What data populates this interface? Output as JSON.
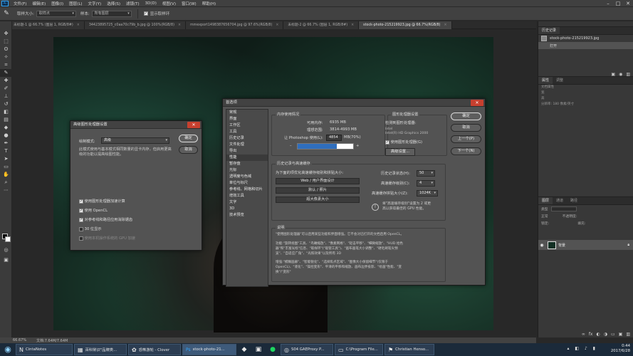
{
  "menubar": {
    "items": [
      "文件(F)",
      "编辑(E)",
      "图像(I)",
      "图层(L)",
      "文字(Y)",
      "选择(S)",
      "滤镜(T)",
      "3D(D)",
      "视图(V)",
      "窗口(W)",
      "帮助(H)"
    ],
    "window_controls": [
      "–",
      "□",
      "✕"
    ]
  },
  "options": {
    "sample_size_label": "取样大小:",
    "sample_size_value": "取样点",
    "sample_label": "样本:",
    "sample_value": "所有图层",
    "show_ring_label": "显示取样环"
  },
  "tabs": [
    {
      "label": "未标题-1 @ 66.7% (图层 1, RGB/8#)",
      "active": false
    },
    {
      "label": "34423895725_c0aa70c79b_b.jpg @ 100%(RGB/8)",
      "active": false
    },
    {
      "label": "mmexport1498387656704.jpg @ 97.6%(RGB/8)",
      "active": false
    },
    {
      "label": "未标题-2 @ 66.7% (图层 1, RGB/8#)",
      "active": false
    },
    {
      "label": "stock-photo-215219923.jpg @ 66.7%(RGB/8)",
      "active": true
    }
  ],
  "statusbar": {
    "zoom": "66.67%",
    "doc": "文档:7.64M/7.64M"
  },
  "gpu_dialog": {
    "title": "高级图形处理器设置",
    "mode_label": "绘制模式:",
    "mode_value": "高级",
    "description": "此模式使用与基本模式相同数量的显卡内存，但启用更高级的功能以提高绘图性能。",
    "ok": "确定",
    "cancel": "取消",
    "options": [
      {
        "label": "使用图形处理器加速计算",
        "checked": true,
        "enabled": true
      },
      {
        "label": "使用 OpenCL",
        "checked": true,
        "enabled": true
      },
      {
        "label": "对参考线和路径应用消除锯齿",
        "checked": true,
        "enabled": true
      },
      {
        "label": "30 位显示",
        "checked": false,
        "enabled": true
      },
      {
        "label": "使用本机操作系统的 GPU 加速",
        "checked": false,
        "enabled": false
      }
    ]
  },
  "prefs_dialog": {
    "title": "首选项",
    "nav": [
      "常规",
      "界面",
      "工作区",
      "工具",
      "历史记录",
      "文件处理",
      "导出",
      "性能",
      "暂存盘",
      "光标",
      "透明度与色域",
      "单位与标尺",
      "参考线、网格和切片",
      "增效工具",
      "文字",
      "3D",
      "技术预览"
    ],
    "nav_selected": "性能",
    "buttons": {
      "ok": "确定",
      "cancel": "取消",
      "prev": "上一个(P)",
      "next": "下一个(N)"
    },
    "memory": {
      "heading": "内存使用情况",
      "available_label": "可用内存:",
      "available_value": "6935 MB",
      "ideal_label": "理想范围:",
      "ideal_value": "3814-4993 MB",
      "let_label": "让 Photoshop 使用(L):",
      "let_value": "4854",
      "let_suffix": "MB(70%)",
      "slider_percent": 70,
      "minus": "–",
      "plus": "+"
    },
    "gpu": {
      "heading": "图形处理器设置",
      "detected_label": "检测到图形处理器:",
      "gpu_vendor": "Intel",
      "gpu_name": "Intel(R) HD Graphics 2000",
      "use_gpu_label": "使用图形处理器(G)",
      "advanced_button": "高级设置..."
    },
    "history": {
      "heading": "历史记录与高速缓存",
      "optimize_text": "为下面的项优化高速缓存级别和拼贴大小:",
      "presets": [
        "Web / 用户界面设计",
        "默认 / 照片",
        "超大像素大小"
      ],
      "states_label": "历史记录状态(H):",
      "states_value": "50",
      "cache_levels_label": "高速缓存级别(C):",
      "cache_levels_value": "4",
      "tile_size_label": "高速缓存拼贴大小(Z):",
      "tile_size_value": "1024K",
      "info_text_1": "将\"高速缓存级别\"设置为 2 或更",
      "info_text_2": "高以获得最佳的 GPU 性能。"
    },
    "description": {
      "heading": "说明",
      "lines": [
        "\"使用图形处理器\"可以启用某些功能和界面增强。它不会对已打开的文档启用 OpenCL。",
        "功能:\"旋转视图\"工具、\"鸟瞰缩放\"、\"像素网格\"、\"轻击平移\"、\"细微缩放\"、\"HUD 拾色",
        "器\"和\"丰富光标\"信息、\"取样环\"(\"吸管工具\")、\"画布画笔大小调整\"、\"硬毛刷笔尖预",
        "览\"、\"自适应广角\"、\"光照效果\"以及所有 3D",
        "增强:\"模糊画廊\"、\"智能锐化\"、\"选择焦点区域\"、\"图像大小保留细节\"(仅限于",
        "OpenCL)、\"液化\"、\"操控变形\"、平滑的平移和缩放、画布边界投影、\"绘画\"性能、\"变",
        "换\"/\"变形\""
      ]
    }
  },
  "right_panel": {
    "history_tabs": [
      "历史记录"
    ],
    "history_items": [
      {
        "label": "stock-photo-215219923.jpg",
        "selected": false
      },
      {
        "label": "打开",
        "selected": true
      }
    ],
    "props_tabs": [
      "属性",
      "调整"
    ],
    "props_rows": [
      "文档属性",
      "宽",
      "高",
      "分辨率: 180 像素/英寸"
    ],
    "layers_tabs": [
      "图层",
      "通道",
      "路径"
    ],
    "layers_kind": "类型",
    "layers_mode": "正常",
    "layers_opacity": "不透明度:",
    "layers_lock": "锁定:",
    "layers_fill": "填充:",
    "layer_name": "背景"
  },
  "taskbar": {
    "tasks": [
      {
        "label": "CintaNotes",
        "icon": "N"
      },
      {
        "label": "百科常识\"品牌类...",
        "icon": "▦"
      },
      {
        "label": "恐怖游轮 - Clover",
        "icon": "✿"
      },
      {
        "label": "stock-photo-21...",
        "icon": "Ps"
      },
      {
        "label": "",
        "icon": "◆"
      },
      {
        "label": "",
        "icon": "▣"
      },
      {
        "label": "",
        "icon": "●"
      },
      {
        "label": "S04 GAEProxy P...",
        "icon": "◎"
      },
      {
        "label": "C:\\Program File...",
        "icon": "▭"
      },
      {
        "label": "Christian Henso...",
        "icon": "⚑"
      }
    ],
    "time": "0:44",
    "date": "2017/6/28"
  },
  "colors": {
    "accent": "#31a8ff",
    "close": "#c7402f",
    "selection_blue": "#2f6ebd"
  }
}
